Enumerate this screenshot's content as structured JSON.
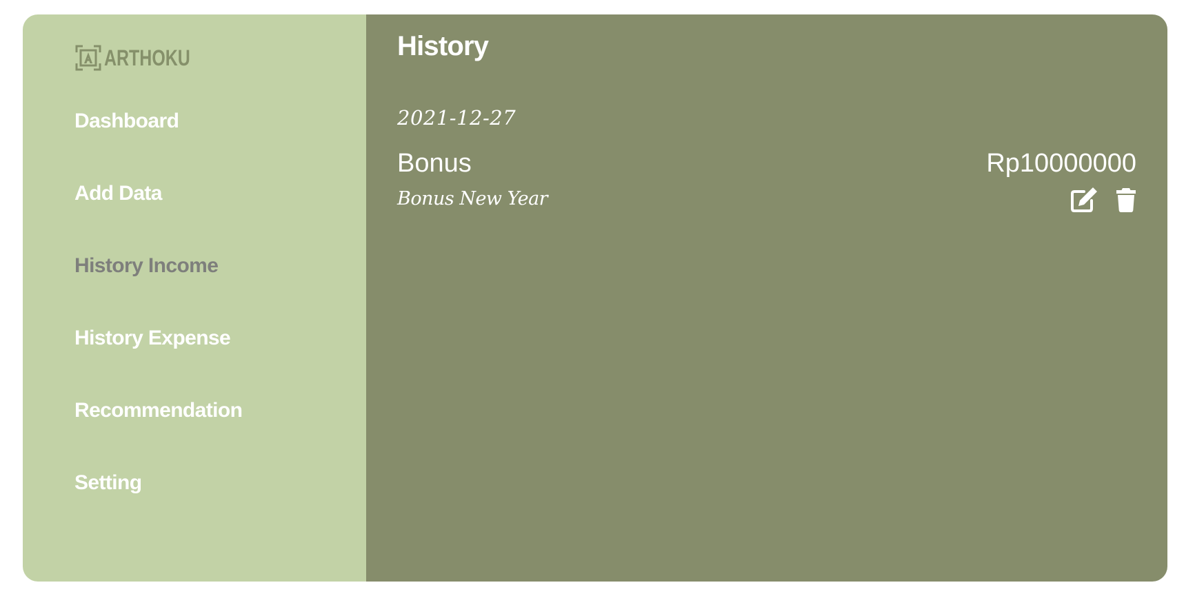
{
  "brand": {
    "logo_icon": "arthoku-logo-icon",
    "name": "ARTHOKU"
  },
  "sidebar": {
    "items": [
      {
        "label": "Dashboard",
        "active": false
      },
      {
        "label": "Add Data",
        "active": false
      },
      {
        "label": "History Income",
        "active": true
      },
      {
        "label": "History Expense",
        "active": false
      },
      {
        "label": "Recommendation",
        "active": false
      },
      {
        "label": "Setting",
        "active": false
      }
    ]
  },
  "main": {
    "title": "History",
    "entries": [
      {
        "date": "2021-12-27",
        "title": "Bonus",
        "amount": "Rp10000000",
        "note": "Bonus New Year",
        "actions": [
          {
            "icon": "edit-icon"
          },
          {
            "icon": "trash-icon"
          }
        ]
      }
    ]
  },
  "colors": {
    "sidebar_bg": "#c2d2a6",
    "main_bg": "#868d6b",
    "active_nav": "#7e7f7c",
    "text": "#ffffff"
  }
}
